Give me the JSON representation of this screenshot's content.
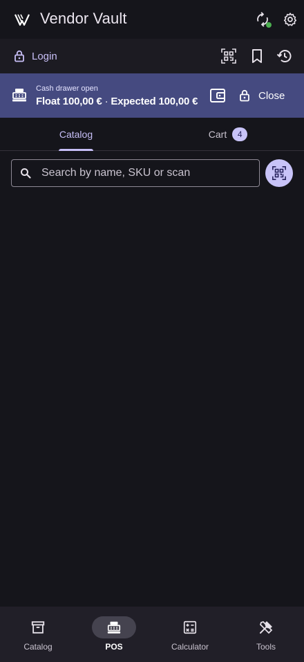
{
  "app": {
    "title": "Vendor Vault",
    "icons": {
      "logo": "vendor-vault-logo",
      "sync": "sync-icon",
      "settings": "gear-icon"
    },
    "sync_status_color": "#4caf50"
  },
  "subbar": {
    "login_label": "Login",
    "icons": [
      "qr-scan-icon",
      "bookmark-icon",
      "history-icon"
    ]
  },
  "drawer": {
    "status": "Cash drawer open",
    "float": "Float 100,00 €",
    "separator": "·",
    "expected": "Expected 100,00 €",
    "close_label": "Close",
    "background_color": "#454a80"
  },
  "tabs": [
    {
      "label": "Catalog",
      "active": true
    },
    {
      "label": "Cart",
      "active": false,
      "badge": "4"
    }
  ],
  "search": {
    "placeholder": "Search by name, SKU or scan",
    "value": ""
  },
  "bottom_nav": [
    {
      "label": "Catalog",
      "icon": "archive-box-icon",
      "active": false
    },
    {
      "label": "POS",
      "icon": "cash-register-icon",
      "active": true
    },
    {
      "label": "Calculator",
      "icon": "calculator-icon",
      "active": false
    },
    {
      "label": "Tools",
      "icon": "tools-icon",
      "active": false
    }
  ],
  "colors": {
    "background": "#15151b",
    "accent": "#c8c3f8",
    "surface": "#1c1b22",
    "nav_surface": "#211f28"
  }
}
